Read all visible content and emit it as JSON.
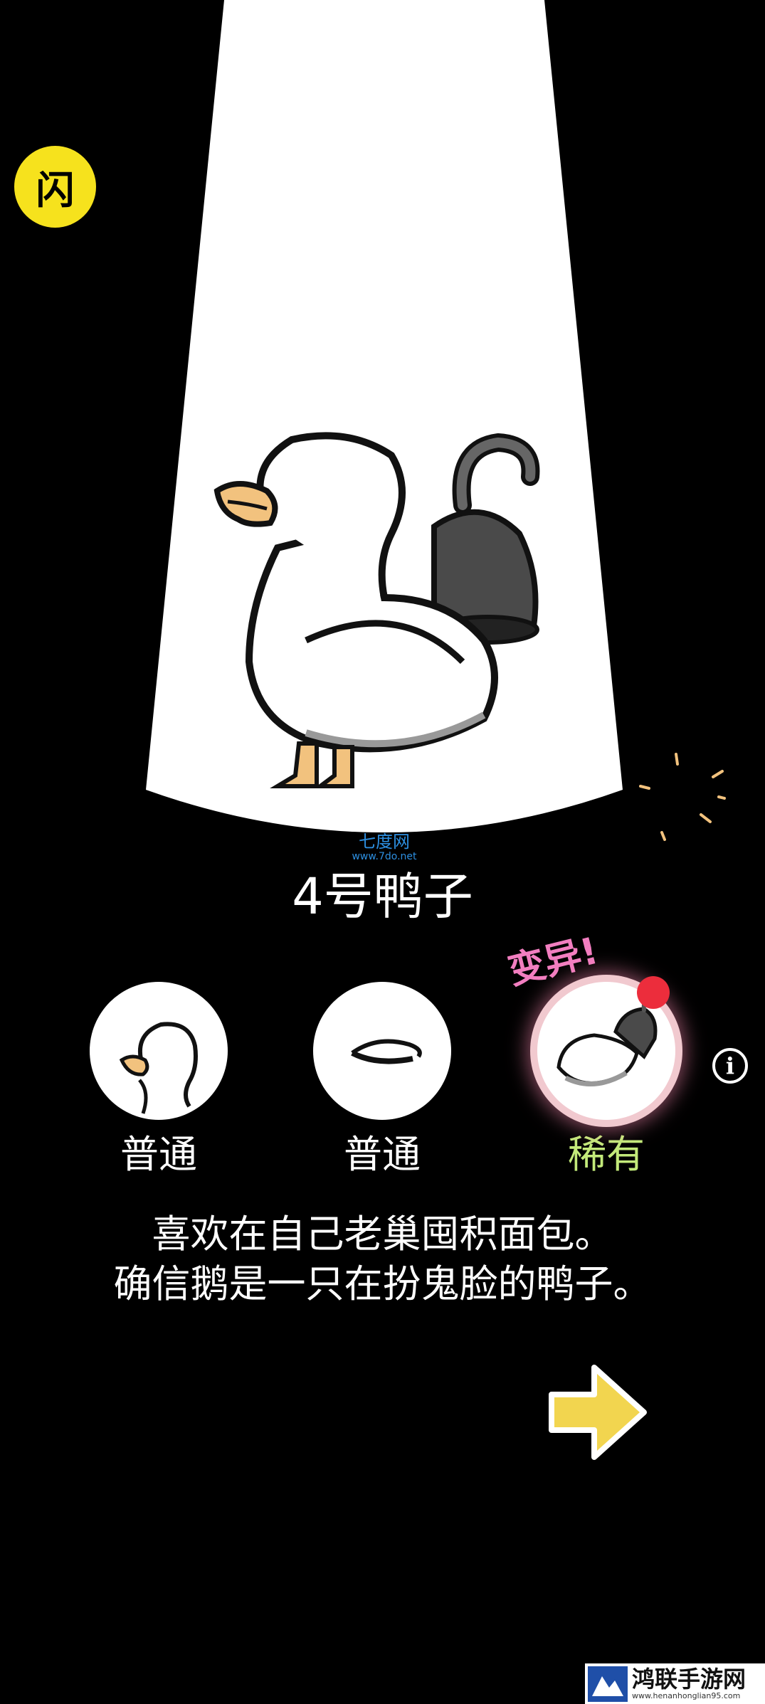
{
  "flash_button": {
    "icon": "flash-icon",
    "label": "闪",
    "color": "#f6e21d"
  },
  "watermark": {
    "site_name": "七度网",
    "url": "www.7do.net"
  },
  "duck": {
    "name": "4号鸭子"
  },
  "mutation": {
    "label": "变异!"
  },
  "traits": [
    {
      "rarity": "普通",
      "part": "head"
    },
    {
      "rarity": "普通",
      "part": "body"
    },
    {
      "rarity": "稀有",
      "part": "tail"
    }
  ],
  "info_button": {
    "icon": "info-icon",
    "label": "i"
  },
  "description": {
    "line1": "喜欢在自己老巢囤积面包。",
    "line2": "确信鹅是一只在扮鬼脸的鸭子。"
  },
  "next_button": {
    "icon": "arrow-right-icon",
    "color": "#f2d54f"
  },
  "footer_watermark": {
    "name": "鸿联手游网",
    "url": "www.henanhonglian95.com"
  },
  "colors": {
    "rare": "#c3ea7a",
    "mutation": "#f27ec0",
    "beak": "#f2c27e"
  }
}
